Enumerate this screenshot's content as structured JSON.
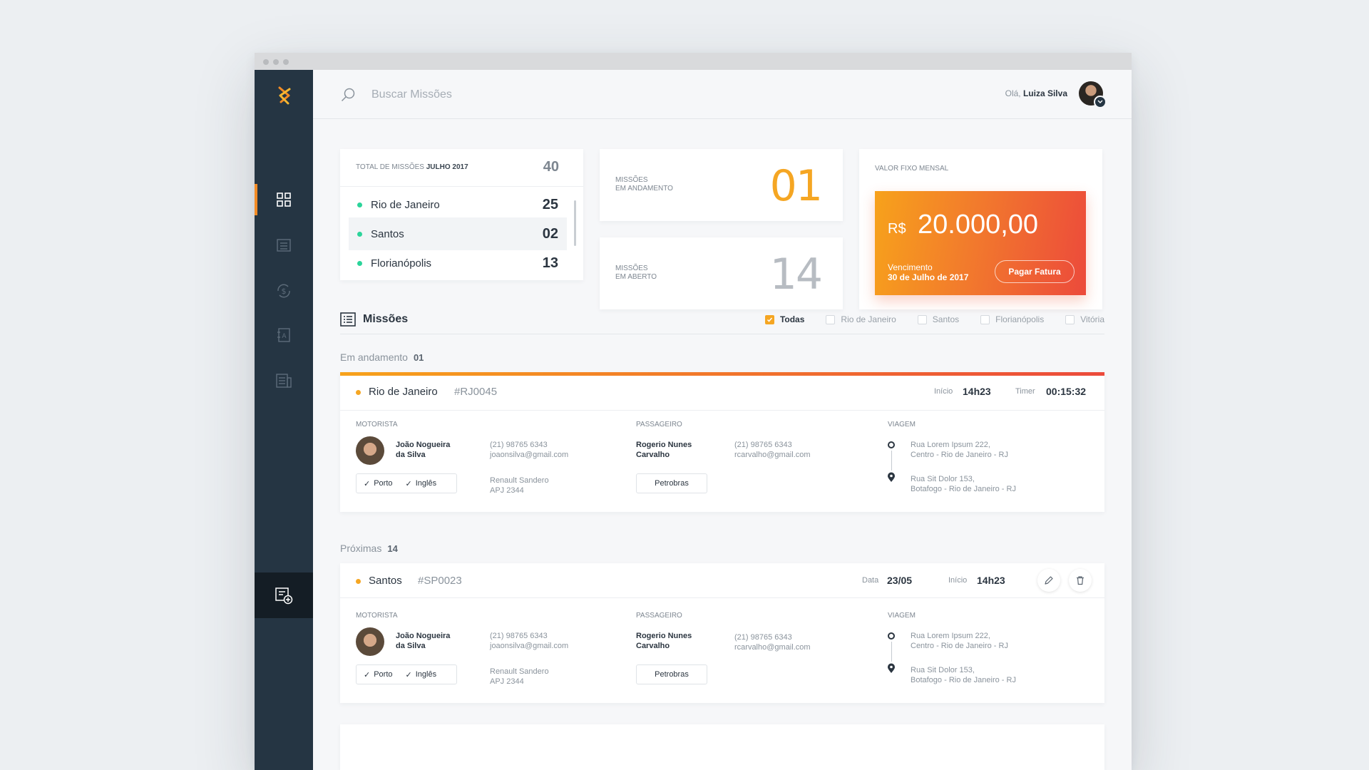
{
  "search": {
    "placeholder": "Buscar Missões"
  },
  "user": {
    "greeting": "Olá,",
    "name": "Luiza Silva"
  },
  "sidebar": {
    "items": [
      {
        "icon": "dashboard-grid-icon",
        "active": true
      },
      {
        "icon": "list-icon",
        "active": false
      },
      {
        "icon": "money-cycle-icon",
        "active": false
      },
      {
        "icon": "contacts-book-icon",
        "active": false
      },
      {
        "icon": "report-icon",
        "active": false
      }
    ],
    "bottom_icon": "add-mission-icon"
  },
  "total_card": {
    "label": "TOTAL DE MISSÕES",
    "period": "JULHO 2017",
    "total": "40",
    "cities": [
      {
        "name": "Rio de Janeiro",
        "count": "25"
      },
      {
        "name": "Santos",
        "count": "02"
      },
      {
        "name": "Florianópolis",
        "count": "13"
      }
    ]
  },
  "stats": {
    "in_progress": {
      "label1": "MISSÕES",
      "label2": "EM ANDAMENTO",
      "value": "01"
    },
    "open": {
      "label1": "MISSÕES",
      "label2": "EM ABERTO",
      "value": "14"
    }
  },
  "payment": {
    "label": "VALOR FIXO MENSAL",
    "currency": "R$",
    "value": "20.000,00",
    "due_label": "Vencimento",
    "due_date": "30 de Julho de 2017",
    "button": "Pagar Fatura"
  },
  "missions_section": {
    "title": "Missões",
    "filters": [
      {
        "label": "Todas",
        "checked": true
      },
      {
        "label": "Rio de Janeiro",
        "checked": false
      },
      {
        "label": "Santos",
        "checked": false
      },
      {
        "label": "Florianópolis",
        "checked": false
      },
      {
        "label": "Vitória",
        "checked": false
      }
    ]
  },
  "groups": {
    "in_progress": {
      "label": "Em andamento",
      "count": "01"
    },
    "upcoming": {
      "label": "Próximas",
      "count": "14"
    }
  },
  "column_labels": {
    "driver": "MOTORISTA",
    "passenger": "PASSAGEIRO",
    "trip": "VIAGEM"
  },
  "missions": [
    {
      "city": "Rio de Janeiro",
      "code": "#RJ0045",
      "meta1_label": "Início",
      "meta1_value": "14h23",
      "meta2_label": "Timer",
      "meta2_value": "00:15:32",
      "driver": {
        "name1": "João Nogueira",
        "name2": "da Silva",
        "phone": "(21) 98765 6343",
        "email": "joaonsilva@gmail.com",
        "car": "Renault Sandero",
        "plate": "APJ 2344",
        "tags": [
          "Porto",
          "Inglês"
        ]
      },
      "passenger": {
        "name1": "Rogerio Nunes",
        "name2": "Carvalho",
        "phone": "(21) 98765 6343",
        "email": "rcarvalho@gmail.com",
        "company": "Petrobras"
      },
      "trip": {
        "from1": "Rua Lorem Ipsum 222,",
        "from2": "Centro - Rio de Janeiro - RJ",
        "to1": "Rua Sit Dolor 153,",
        "to2": "Botafogo - Rio de Janeiro - RJ"
      }
    },
    {
      "city": "Santos",
      "code": "#SP0023",
      "meta1_label": "Data",
      "meta1_value": "23/05",
      "meta2_label": "Início",
      "meta2_value": "14h23",
      "driver": {
        "name1": "João Nogueira",
        "name2": "da Silva",
        "phone": "(21) 98765 6343",
        "email": "joaonsilva@gmail.com",
        "car": "Renault Sandero",
        "plate": "APJ 2344",
        "tags": [
          "Porto",
          "Inglês"
        ]
      },
      "passenger": {
        "name1": "Rogerio Nunes",
        "name2": "Carvalho",
        "phone": "(21) 98765 6343",
        "email": "rcarvalho@gmail.com",
        "company": "Petrobras"
      },
      "trip": {
        "from1": "Rua Lorem Ipsum 222,",
        "from2": "Centro - Rio de Janeiro - RJ",
        "to1": "Rua Sit Dolor 153,",
        "to2": "Botafogo - Rio de Janeiro - RJ"
      }
    }
  ],
  "colors": {
    "accent_orange": "#f5a623",
    "gradient_start": "#f7a21b",
    "gradient_end": "#ec4a3b",
    "sidebar": "#253543",
    "green_dot": "#2bd49a"
  }
}
